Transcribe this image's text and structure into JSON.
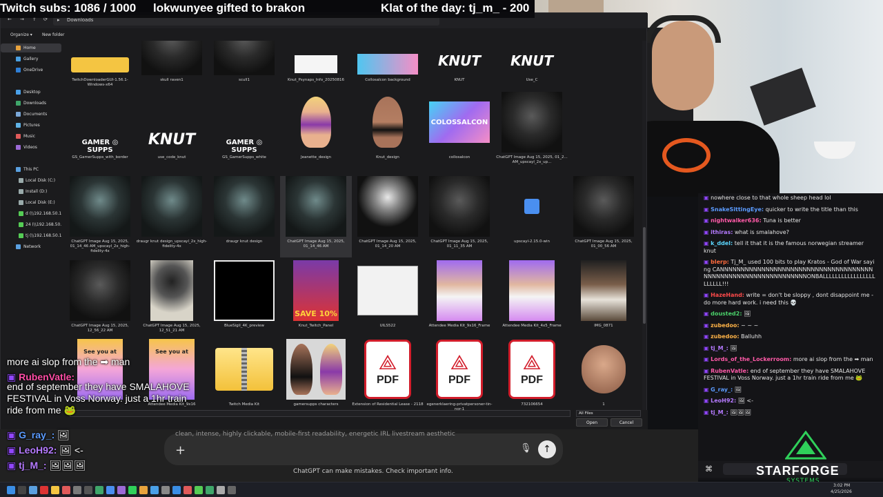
{
  "overlay": {
    "subs": "Twitch subs: 1086 / 1000",
    "gift": "lokwunyee gifted to brakon",
    "klat": "Klat of the day: tj_m_ - 200"
  },
  "explorer": {
    "breadcrumb": "Downloads",
    "organize": "Organize ▾",
    "new_folder": "New folder",
    "sidebar": [
      {
        "label": "Home",
        "color": "#e8a33d"
      },
      {
        "label": "Gallery",
        "color": "#4a9fe0"
      },
      {
        "label": "OneDrive",
        "color": "#2f7fd6"
      },
      {
        "label": "Desktop",
        "color": "#4aa0e8"
      },
      {
        "label": "Downloads",
        "color": "#3fa66a"
      },
      {
        "label": "Documents",
        "color": "#7aa7d8"
      },
      {
        "label": "Pictures",
        "color": "#5fb2e6"
      },
      {
        "label": "Music",
        "color": "#e05a5a"
      },
      {
        "label": "Videos",
        "color": "#9c6ad6"
      },
      {
        "label": "This PC",
        "color": "#5aa0e0"
      },
      {
        "label": "Local Disk (C:)",
        "color": "#9aa"
      },
      {
        "label": "Install (D:)",
        "color": "#9aa"
      },
      {
        "label": "Local Disk (E:)",
        "color": "#9aa"
      },
      {
        "label": "d (\\\\192.168.50.15",
        "color": "#5c5"
      },
      {
        "label": "24 (\\\\192.168.50.1",
        "color": "#5c5"
      },
      {
        "label": "tj (\\\\192.168.50.1",
        "color": "#5c5"
      },
      {
        "label": "Network",
        "color": "#5aa0e0"
      }
    ],
    "files": [
      {
        "name": "TwitchDownloaderGUI-1.56.1-Windows-x64",
        "kind": "folder"
      },
      {
        "name": "skull raven1",
        "kind": "dark"
      },
      {
        "name": "scull1",
        "kind": "dark"
      },
      {
        "name": "Knut_Psynaps_Info_20250816",
        "kind": "doc"
      },
      {
        "name": "Collosalcon background",
        "kind": "banner"
      },
      {
        "name": "KNUT",
        "kind": "knut"
      },
      {
        "name": "Use_C",
        "kind": "knut"
      },
      {
        "name": "GS_GamerSupps_with_border",
        "kind": "gs"
      },
      {
        "name": "use_code_knut",
        "kind": "usecode"
      },
      {
        "name": "GS_GamerSupps_white",
        "kind": "gs"
      },
      {
        "name": "Jeanette_design",
        "kind": "figure-f"
      },
      {
        "name": "Knut_design",
        "kind": "figure-m"
      },
      {
        "name": "collosalcon",
        "kind": "banner-big"
      },
      {
        "name": "ChatGPT Image Aug 15, 2025, 01_2... AM_upscayl_2x_up...",
        "kind": "dark"
      },
      {
        "name": "ChatGPT Image Aug 15, 2025, 01_14_46 AM_upscayl_2x_high-fidelity-4x",
        "kind": "warrior"
      },
      {
        "name": "draugr knut design_upscayl_2x_high-fidelity-4x",
        "kind": "warrior"
      },
      {
        "name": "draugr knut design",
        "kind": "warrior"
      },
      {
        "name": "ChatGPT Image Aug 15, 2025, 01_14_46 AM",
        "kind": "warrior"
      },
      {
        "name": "ChatGPT Image Aug 15, 2025, 01_14_20 AM",
        "kind": "skeleton"
      },
      {
        "name": "ChatGPT Image Aug 15, 2025, 01_11_35 AM",
        "kind": "dark"
      },
      {
        "name": "upscayl-2.15.0-win",
        "kind": "app"
      },
      {
        "name": "ChatGPT Image Aug 15, 2025, 01_00_56 AM",
        "kind": "dark"
      },
      {
        "name": "ChatGPT Image Aug 15, 2025, 12_56_22 AM",
        "kind": "dark"
      },
      {
        "name": "ChatGPT Image Aug 15, 2025, 12_51_21 AM",
        "kind": "skeleton-light"
      },
      {
        "name": "BlueSigil_4K_preview",
        "kind": "black"
      },
      {
        "name": "Knut_Twitch_Panel",
        "kind": "save10"
      },
      {
        "name": "UILS522",
        "kind": "report"
      },
      {
        "name": "Attendee Media Kit_9x16_Frame",
        "kind": "photo-purple"
      },
      {
        "name": "Attendee Media Kit_4x5_Frame",
        "kind": "photo-purple"
      },
      {
        "name": "IMG_0871",
        "kind": "photo"
      },
      {
        "name": "",
        "kind": "seeyou"
      },
      {
        "name": "Attendee Media Kit_9x16",
        "kind": "seeyou"
      },
      {
        "name": "Twitch Media Kit",
        "kind": "zip"
      },
      {
        "name": "gamersupps characters",
        "kind": "characters"
      },
      {
        "name": "Extension of Residential Lease - 2118",
        "kind": "pdf"
      },
      {
        "name": "egenerklaering-privatpersoner-tin-nor-1",
        "kind": "pdf"
      },
      {
        "name": "732106654",
        "kind": "pdf"
      },
      {
        "name": "1",
        "kind": "head"
      }
    ],
    "filter": "All Files",
    "open_label": "Open",
    "cancel_label": "Cancel"
  },
  "chat": {
    "messages": [
      {
        "user": "",
        "color": "#999",
        "text": "nowhere close to that whole sheep head lol"
      },
      {
        "user": "SnakeSittingEye:",
        "color": "#5b9bff",
        "text": " quicker to write the title than this"
      },
      {
        "user": "nightwalker636:",
        "color": "#ff5aa8",
        "text": " Tuna is better"
      },
      {
        "user": "ithiras:",
        "color": "#b57aff",
        "text": " what is smalahove?"
      },
      {
        "user": "k_ddel:",
        "color": "#5bd7ff",
        "text": " tell it that it is the famous norwegian streamer knut"
      },
      {
        "user": "blerp:",
        "color": "#ff6b3d",
        "text": " Tj_M_ used 100 bits to play Kratos - God of War saying CANNNNNNNNNNNNNNNNNNNNNNNNNNNNNNNNNNNNNNNNNNNNNNNNNNNNNNNNNNNNNNONBALLLLLLLLLLLLLLLLLLLLLLL!!!"
      },
      {
        "user": "HazeHand:",
        "color": "#ff4a4a",
        "text": " write = don't be sloppy , dont disappoint me - do more hard work. i need this 💀"
      },
      {
        "user": "dousted2:",
        "color": "#4ad06a",
        "text": " 🖼"
      },
      {
        "user": "zubedoo:",
        "color": "#ffb347",
        "text": " ~ ~ ~"
      },
      {
        "user": "zubedoo:",
        "color": "#ffb347",
        "text": " Balluhh"
      },
      {
        "user": "tj_M_:",
        "color": "#b57aff",
        "text": " 🖼"
      },
      {
        "user": "Lords_of_the_Lockerroom:",
        "color": "#ff5aa8",
        "text": " more ai slop from the ➡ man"
      },
      {
        "user": "RubenVatle:",
        "color": "#ff5aa8",
        "text": " end of september they have SMALAHOVE FESTIVAL in Voss Norway. just a 1hr train ride from me 🐸"
      },
      {
        "user": "G_ray_:",
        "color": "#5b9bff",
        "text": " 🖼"
      },
      {
        "user": "LeoH92:",
        "color": "#b57aff",
        "text": " 🖼 <-"
      },
      {
        "user": "tj_M_:",
        "color": "#b57aff",
        "text": " 🖼🖼🖼"
      }
    ]
  },
  "overlay_chat": {
    "lines": [
      {
        "user": "",
        "color": "#fff",
        "text": "more ai slop from the ➡ man"
      },
      {
        "user": "RubenVatle:",
        "color": "#ff4da6",
        "text": ""
      },
      {
        "user": "",
        "color": "#fff",
        "text": "end of september they have SMALAHOVE FESTIVAL in Voss Norway. just a 1hr train ride from me 🐸"
      },
      {
        "user": "G_ray_:",
        "color": "#5b9bff",
        "text": " 🖼"
      },
      {
        "user": "LeoH92:",
        "color": "#b57aff",
        "text": " 🖼 <-"
      },
      {
        "user": "tj_M_:",
        "color": "#b57aff",
        "text": " 🖼🖼🖼"
      }
    ]
  },
  "chatgpt": {
    "placeholder": "clean, intense, highly clickable, mobile-first readability, energetic IRL livestream aesthetic",
    "disclaimer": "ChatGPT can make mistakes. Check important info."
  },
  "brand": {
    "name": "STARFORGE",
    "sub": "SYSTEMS"
  },
  "taskbar": {
    "time": "3:02 PM",
    "date": "4/25/2026"
  }
}
